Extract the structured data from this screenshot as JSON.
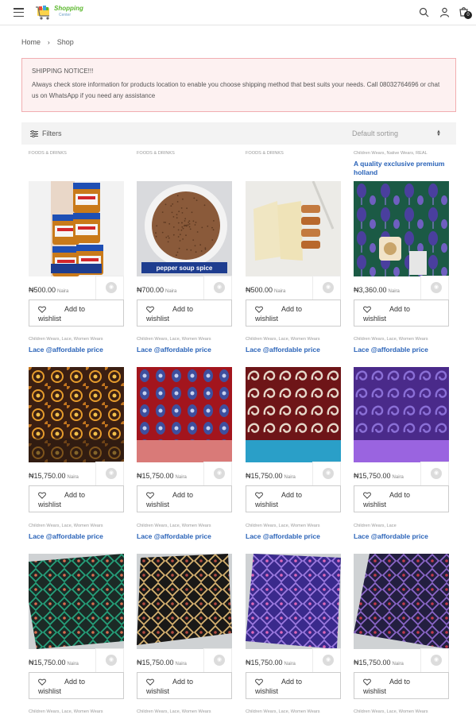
{
  "header": {
    "logo_text": "Shopping",
    "logo_subtext": "Center",
    "cart_count": "0"
  },
  "breadcrumb": {
    "home": "Home",
    "current": "Shop"
  },
  "notice": {
    "title": "SHIPPING NOTICE!!!",
    "body": "Always check store information for products location to enable you choose shipping method that best suits your needs. Call 08032764696 or chat us on WhatsApp if you need any assistance"
  },
  "toolbar": {
    "filters_label": "Filters",
    "sort_label": "Default sorting"
  },
  "wishlist": {
    "line1": "Add to",
    "line2": "wishlist"
  },
  "currency_suffix": "Naira",
  "products": [
    {
      "category": "FOODS & DRINKS",
      "title": "",
      "price": "₦500.00",
      "image": "peanut-butter-jars"
    },
    {
      "category": "FOODS & DRINKS",
      "title": "",
      "price": "₦700.00",
      "image": "pepper-soup-spice-bowl",
      "image_caption": "pepper soup spice"
    },
    {
      "category": "FOODS & DRINKS",
      "title": "",
      "price": "₦500.00",
      "image": "flour-and-spice-packs"
    },
    {
      "category": "Children Wears, Native Wears, REAL",
      "title": "A quality exclusive premium holland",
      "price": "₦3,360.00",
      "image": "green-purple-holland-fabric"
    },
    {
      "category": "Children Wears, Lace, Women Wears",
      "title": "Lace @affordable price",
      "price": "₦15,750.00",
      "image": "brown-gold-lace"
    },
    {
      "category": "Children Wears, Lace, Women Wears",
      "title": "Lace @affordable price",
      "price": "₦15,750.00",
      "image": "red-blue-lace"
    },
    {
      "category": "Children Wears, Lace, Women Wears",
      "title": "Lace @affordable price",
      "price": "₦15,750.00",
      "image": "maroon-blue-lace"
    },
    {
      "category": "Children Wears, Lace, Women Wears",
      "title": "Lace @affordable price",
      "price": "₦15,750.00",
      "image": "purple-lace"
    },
    {
      "category": "Children Wears, Lace, Women Wears",
      "title": "Lace @affordable price",
      "price": "₦15,750.00",
      "image": "green-diamond-lace"
    },
    {
      "category": "Children Wears, Lace, Women Wears",
      "title": "Lace @affordable price",
      "price": "₦15,750.00",
      "image": "black-gold-diamond-lace"
    },
    {
      "category": "Children Wears, Lace, Women Wears",
      "title": "Lace @affordable price",
      "price": "₦15,750.00",
      "image": "purple-blue-diamond-lace"
    },
    {
      "category": "Children Wears, Lace",
      "title": "Lace @affordable price",
      "price": "₦15,750.00",
      "image": "navy-red-diamond-lace"
    }
  ],
  "next_row_categories": [
    "Children Wears, Lace, Women Wears",
    "Children Wears, Lace, Women Wears",
    "Children Wears, Lace, Women Wears",
    "Children Wears, Lace, Women Wears"
  ],
  "colors": {
    "accent_blue": "#2a63b8",
    "notice_border": "#f1aeb1",
    "notice_bg": "#fdf1f1",
    "logo_green": "#5cb82e"
  }
}
